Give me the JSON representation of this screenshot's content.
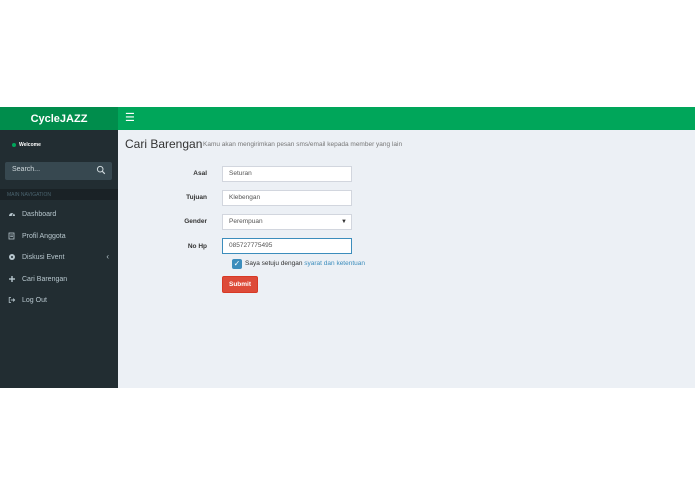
{
  "header": {
    "brand": "CycleJAZZ",
    "menu_icon": "hamburger-icon",
    "accent": "#00a65a"
  },
  "sidebar": {
    "welcome": "Welcome",
    "search_placeholder": "Search...",
    "nav_heading": "MAIN NAVIGATION",
    "items": [
      {
        "label": "Dashboard",
        "icon": "dashboard-icon"
      },
      {
        "label": "Profil Anggota",
        "icon": "profile-icon"
      },
      {
        "label": "Diskusi Event",
        "icon": "event-icon"
      },
      {
        "label": "Cari Barengan",
        "icon": "plus-icon"
      },
      {
        "label": "Log Out",
        "icon": "logout-icon"
      }
    ]
  },
  "main": {
    "title": "Cari Barengan",
    "subtitle": "Kamu akan mengirimkan pesan sms/email kepada member yang lain",
    "form": {
      "asal_label": "Asal",
      "asal_value": "Seturan",
      "tujuan_label": "Tujuan",
      "tujuan_value": "Klebengan",
      "gender_label": "Gender",
      "gender_value": "Perempuan",
      "nohp_label": "No Hp",
      "nohp_value": "085727775495",
      "agree_text": "Saya setuju dengan ",
      "agree_link": "syarat dan ketentuan",
      "submit_label": "Submit"
    }
  }
}
